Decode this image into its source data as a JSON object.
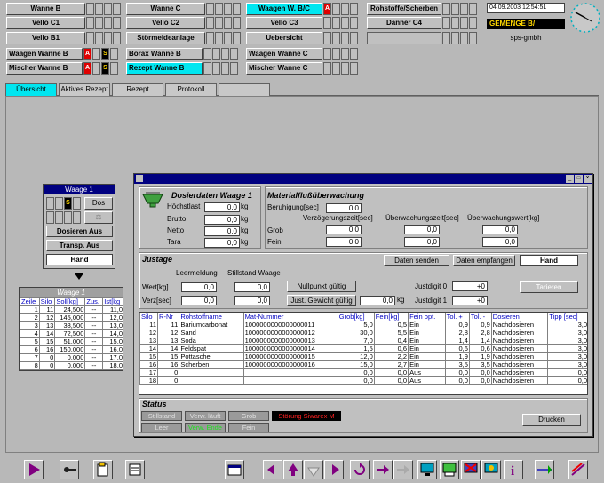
{
  "topbar": {
    "row1": [
      {
        "label": "Wanne B"
      },
      {
        "label": "Wanne C"
      },
      {
        "label": "Waagen W. B/C"
      },
      {
        "label": "Rohstoffe/Scherben"
      }
    ],
    "row2": [
      {
        "label": "Vello C1"
      },
      {
        "label": "Vello C2"
      },
      {
        "label": "Vello C3"
      },
      {
        "label": "Danner C4"
      }
    ],
    "row3": [
      {
        "label": "Vello B1"
      },
      {
        "label": "Störmeldeanlage"
      },
      {
        "label": "Uebersicht"
      }
    ],
    "row4": [
      {
        "label": "Waagen Wanne B"
      },
      {
        "label": "Borax Wanne B"
      },
      {
        "label": "Waagen Wanne C"
      }
    ],
    "row5": [
      {
        "label": "Mischer Wanne B"
      },
      {
        "label": "Rezept Wanne B"
      },
      {
        "label": "Mischer Wanne C"
      }
    ],
    "lamp_a": "A",
    "lamp_s": "S",
    "datetime": "04.09.2003 12:54:51",
    "gemenge": "GEMENGE  B/",
    "company": "sps-gmbh"
  },
  "tabs": [
    {
      "label": "Übersicht"
    },
    {
      "label": "Aktives Rezept"
    },
    {
      "label": "Rezept"
    },
    {
      "label": "Protokoll"
    }
  ],
  "waage_panel": {
    "title": "Waage 1",
    "dos": "Dos",
    "dosieren_aus": "Dosieren Aus",
    "transp_aus": "Transp. Aus",
    "hand": "Hand",
    "s": "S"
  },
  "silo_table": {
    "title": "Waage 1",
    "headers": [
      "Zeile",
      "Silo",
      "Soll[kg]",
      "Zus.",
      "Ist[kg"
    ],
    "rows": [
      [
        "1",
        "11",
        "24,500",
        "--",
        "11,0"
      ],
      [
        "2",
        "12",
        "145,000",
        "--",
        "12,0"
      ],
      [
        "3",
        "13",
        "38,500",
        "--",
        "13,0"
      ],
      [
        "4",
        "14",
        "72,500",
        "--",
        "14,0"
      ],
      [
        "5",
        "15",
        "51,000",
        "--",
        "15,0"
      ],
      [
        "6",
        "16",
        "150,000",
        "--",
        "16,0"
      ],
      [
        "7",
        "0",
        "0,000",
        "--",
        "17,0"
      ],
      [
        "8",
        "0",
        "0,000",
        "--",
        "18,0"
      ]
    ]
  },
  "dialog": {
    "dosier": {
      "title": "Dosierdaten Waage 1",
      "hoechstlast": "Höchstlast",
      "brutto": "Brutto",
      "netto": "Netto",
      "tara": "Tara",
      "v1": "0,0",
      "unit": "kg"
    },
    "matfluss": {
      "title": "Materialflußüberwachung",
      "beruhigung": "Beruhigung[sec]",
      "ber_val": "0,0",
      "verz": "Verzögerungszeit[sec]",
      "ueberzeit": "Überwachungszeit[sec]",
      "ueberwert": "Überwachungswert[kg]",
      "grob": "Grob",
      "fein": "Fein",
      "val": "0,0"
    },
    "justage": {
      "title": "Justage",
      "senden": "Daten senden",
      "empfangen": "Daten empfangen",
      "hand": "Hand",
      "leermeldung": "Leermeldung",
      "stillstand": "Stillstand Waage",
      "wert": "Wert[kg]",
      "verz": "Verz[sec]",
      "val": "0,0",
      "nullpunkt": "Nullpunkt gültig",
      "just_gewicht": "Just. Gewicht gültig",
      "jg_val": "0,0",
      "kg": "kg",
      "justdigit0": "Justdigit 0",
      "justdigit1": "Justdigit 1",
      "jd_val": "+0",
      "tarieren": "Tarieren"
    },
    "table": {
      "headers": [
        "Silo",
        "R-Nr",
        "Rohstoffname",
        "Mat-Nummer",
        "Grob[kg]",
        "Fein[kg]",
        "Fein opt.",
        "Tol. +",
        "Tol. -",
        "Dosieren",
        "Tipp [sec]"
      ],
      "rows": [
        [
          "11",
          "11",
          "Bariumcarbonat",
          "1000000000000000011",
          "5,0",
          "0,5",
          "Ein",
          "0,9",
          "0,9",
          "Nachdosieren",
          "3,0"
        ],
        [
          "12",
          "12",
          "Sand",
          "1000000000000000012",
          "30,0",
          "5,5",
          "Ein",
          "2,8",
          "2,8",
          "Nachdosieren",
          "3,0"
        ],
        [
          "13",
          "13",
          "Soda",
          "1000000000000000013",
          "7,0",
          "0,4",
          "Ein",
          "1,4",
          "1,4",
          "Nachdosieren",
          "3,0"
        ],
        [
          "14",
          "14",
          "Feldspat",
          "1000000000000000014",
          "1,5",
          "0,6",
          "Ein",
          "0,6",
          "0,6",
          "Nachdosieren",
          "3,0"
        ],
        [
          "15",
          "15",
          "Pottasche",
          "1000000000000000015",
          "12,0",
          "2,2",
          "Ein",
          "1,9",
          "1,9",
          "Nachdosieren",
          "3,0"
        ],
        [
          "16",
          "16",
          "Scherben",
          "1000000000000000016",
          "15,0",
          "2,7",
          "Ein",
          "3,5",
          "3,5",
          "Nachdosieren",
          "3,0"
        ],
        [
          "17",
          "0",
          "",
          "",
          "0,0",
          "0,0",
          "Aus",
          "0,0",
          "0,0",
          "Nachdosieren",
          "0,0"
        ],
        [
          "18",
          "0",
          "",
          "",
          "0,0",
          "0,0",
          "Aus",
          "0,0",
          "0,0",
          "Nachdosieren",
          "0,0"
        ]
      ]
    },
    "status": {
      "title": "Status",
      "stillstand": "Stillstand",
      "verw_lauft": "Verw. läuft",
      "grob": "Grob",
      "stoerung": "Störung Siwarex M",
      "leer": "Leer",
      "verw_ende": "Verw. Ende",
      "fein": "Fein",
      "drucken": "Drucken"
    }
  },
  "colors": {
    "accent": "#00e6f0",
    "alarm": "#ff2020",
    "ok": "#20d020"
  }
}
